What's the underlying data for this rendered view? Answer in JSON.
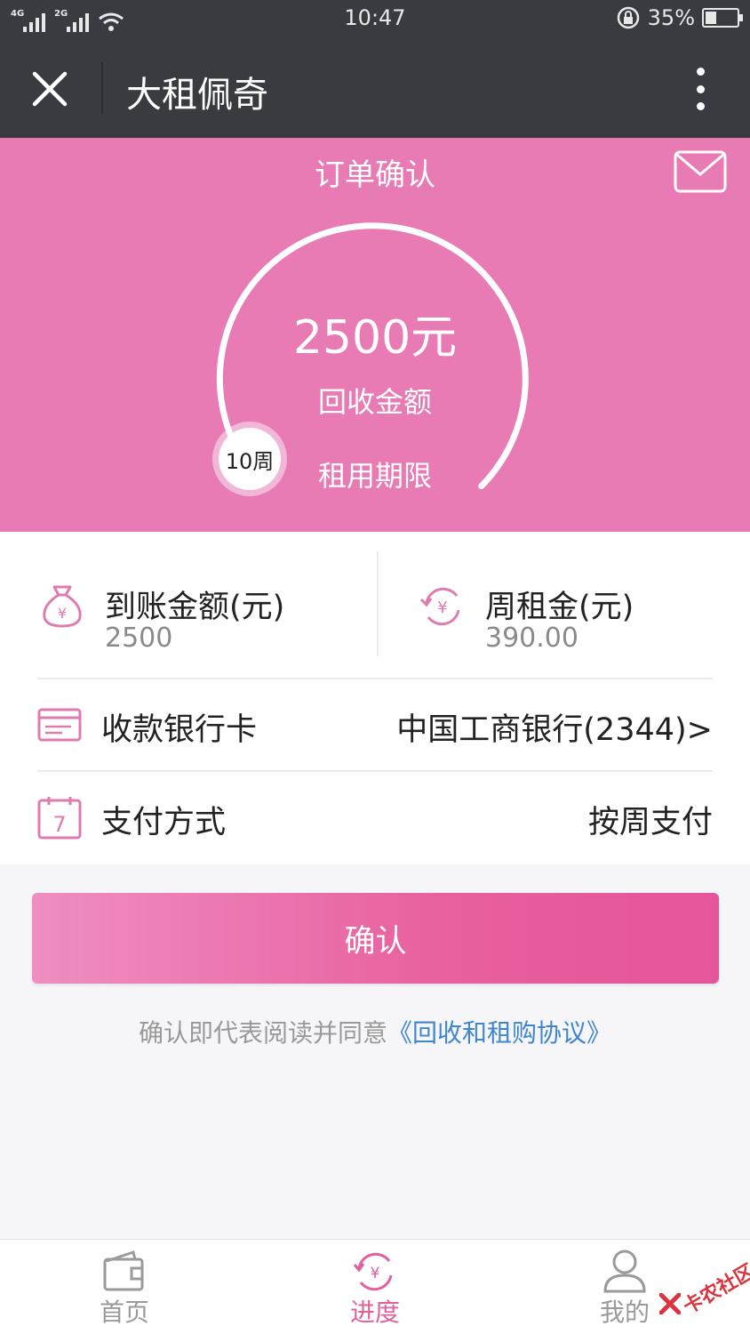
{
  "status_bar": {
    "net_1": "4G",
    "net_2": "2G",
    "time": "10:47",
    "battery": "35%",
    "battery_level": 0.35
  },
  "title_bar": {
    "title": "大租佩奇",
    "close_icon": "close-icon",
    "more_icon": "more-vertical-icon"
  },
  "hero": {
    "page_title": "订单确认",
    "mail_icon": "mail-icon",
    "amount": "2500元",
    "amount_label": "回收金额",
    "term_knob": "10周",
    "term_label": "租用期限",
    "dial_fraction": 0.1,
    "colors": {
      "background": "#e87ab4",
      "ring": "#ffffff"
    }
  },
  "info": {
    "received": {
      "icon": "money-bag-icon",
      "label": "到账金额(元)",
      "value": "2500"
    },
    "weekly_rent": {
      "icon": "yuan-refresh-icon",
      "label": "周租金(元)",
      "value": "390.00"
    },
    "bank_card": {
      "icon": "bank-card-icon",
      "label": "收款银行卡",
      "value": "中国工商银行(2344)>"
    },
    "payment": {
      "icon": "calendar-icon",
      "label": "支付方式",
      "value": "按周支付"
    }
  },
  "confirm": {
    "button_label": "确认",
    "agree_text": "确认即代表阅读并同意",
    "agreement_link": "《回收和租购协议》"
  },
  "tab_bar": {
    "items": [
      {
        "label": "首页",
        "icon": "wallet-icon",
        "active": false
      },
      {
        "label": "进度",
        "icon": "yuan-progress-icon",
        "active": true
      },
      {
        "label": "我的",
        "icon": "user-icon",
        "active": false
      }
    ],
    "active_color": "#e2609c"
  },
  "watermark": {
    "text": "卡农社区"
  },
  "colors": {
    "accent_pink": "#e87ab4",
    "button_pink": "#e5559a",
    "link_blue": "#3f86cf",
    "dark_bar": "#3a3b40"
  }
}
